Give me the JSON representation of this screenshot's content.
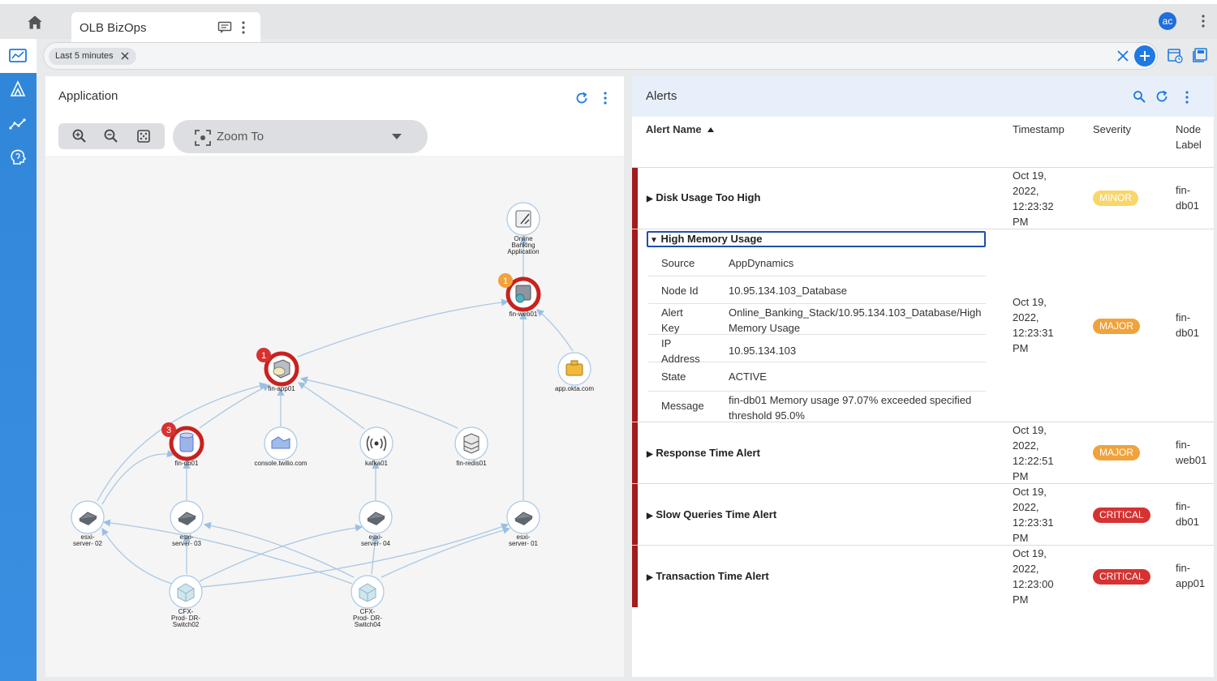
{
  "tab": {
    "title": "OLB BizOps"
  },
  "user": {
    "initials": "ac"
  },
  "filter": {
    "chip_label": "Last 5 minutes"
  },
  "app_panel": {
    "title": "Application",
    "zoom_to_label": "Zoom To",
    "nodes": [
      {
        "label": "Online Banking Application",
        "lines": [
          "Online",
          "Banking",
          "Application"
        ],
        "badge": ""
      },
      {
        "label": "fin-web01",
        "lines": [
          "fin-web01"
        ],
        "badge": "1"
      },
      {
        "label": "fin-app01",
        "lines": [
          "fin-app01"
        ],
        "badge": "1"
      },
      {
        "label": "app.okta.com",
        "lines": [
          "app.okta.com"
        ],
        "badge": ""
      },
      {
        "label": "fin-db01",
        "lines": [
          "fin-db01"
        ],
        "badge": "3"
      },
      {
        "label": "console.twilio.com",
        "lines": [
          "console.twilio.com"
        ],
        "badge": ""
      },
      {
        "label": "kafka01",
        "lines": [
          "kafka01"
        ],
        "badge": ""
      },
      {
        "label": "fin-redis01",
        "lines": [
          "fin-redis01"
        ],
        "badge": ""
      },
      {
        "label": "esxi-server- 02",
        "lines": [
          "esxi-",
          "server- 02"
        ],
        "badge": ""
      },
      {
        "label": "esxi-server- 03",
        "lines": [
          "esxi-",
          "server- 03"
        ],
        "badge": ""
      },
      {
        "label": "esxi-server- 04",
        "lines": [
          "esxi-",
          "server- 04"
        ],
        "badge": ""
      },
      {
        "label": "esxi-server- 01",
        "lines": [
          "esxi-",
          "server- 01"
        ],
        "badge": ""
      },
      {
        "label": "CFX-Prod- DR-Switch02",
        "lines": [
          "CFX-",
          "Prod- DR-",
          "Switch02"
        ],
        "badge": ""
      },
      {
        "label": "CFX-Prod- DR-Switch04",
        "lines": [
          "CFX-",
          "Prod- DR-",
          "Switch04"
        ],
        "badge": ""
      }
    ]
  },
  "alerts_panel": {
    "title": "Alerts",
    "columns": {
      "alert_name": "Alert Name",
      "timestamp": "Timestamp",
      "severity": "Severity",
      "node_label_1": "Node",
      "node_label_2": "Label"
    },
    "rows": [
      {
        "name": "Disk Usage Too High",
        "ts": [
          "Oct 19,",
          "2022,",
          "12:23:32",
          "PM"
        ],
        "severity": "MINOR",
        "node": [
          "fin-",
          "db01"
        ]
      },
      {
        "name": "High Memory Usage",
        "ts": [
          "Oct 19,",
          "2022,",
          "12:23:31",
          "PM"
        ],
        "severity": "MAJOR",
        "node": [
          "fin-",
          "db01"
        ]
      },
      {
        "name": "Response Time Alert",
        "ts": [
          "Oct 19,",
          "2022,",
          "12:22:51",
          "PM"
        ],
        "severity": "MAJOR",
        "node": [
          "fin-",
          "web01"
        ]
      },
      {
        "name": "Slow Queries Time Alert",
        "ts": [
          "Oct 19,",
          "2022,",
          "12:23:31",
          "PM"
        ],
        "severity": "CRITICAL",
        "node": [
          "fin-",
          "db01"
        ]
      },
      {
        "name": "Transaction Time Alert",
        "ts": [
          "Oct 19,",
          "2022,",
          "12:23:00",
          "PM"
        ],
        "severity": "CRITICAL",
        "node": [
          "fin-",
          "app01"
        ]
      }
    ],
    "expanded_details": [
      {
        "key": [
          "Source"
        ],
        "value": [
          "AppDynamics"
        ]
      },
      {
        "key": [
          "Node Id"
        ],
        "value": [
          "10.95.134.103_Database"
        ]
      },
      {
        "key": [
          "Alert",
          "Key"
        ],
        "value": [
          "Online_Banking_Stack/10.95.134.103_Database/High",
          "Memory Usage"
        ]
      },
      {
        "key": [
          "IP",
          "Address"
        ],
        "value": [
          "10.95.134.103"
        ]
      },
      {
        "key": [
          "State"
        ],
        "value": [
          "ACTIVE"
        ]
      },
      {
        "key": [
          "Message"
        ],
        "value": [
          "fin-db01 Memory usage 97.07% exceeded specified",
          "threshold 95.0%"
        ]
      }
    ]
  },
  "colors": {
    "accent": "#1e7ae0",
    "critical_bar": "#a31c1c",
    "minor": "#f9d66a",
    "major": "#f1a23b",
    "critical": "#d63232",
    "edge": "#a9c8e6",
    "alert_ring": "#c8221e"
  },
  "icons": [
    "home-icon",
    "comment-icon",
    "more-vert-icon",
    "dashboard-icon",
    "topology-icon",
    "trend-icon",
    "brain-icon",
    "close-icon",
    "add-icon",
    "calendar-icon",
    "save-icon",
    "refresh-icon",
    "zoom-in-icon",
    "zoom-out-icon",
    "fit-icon",
    "search-icon",
    "sort-asc-icon",
    "caret-right-icon",
    "caret-down-icon"
  ]
}
